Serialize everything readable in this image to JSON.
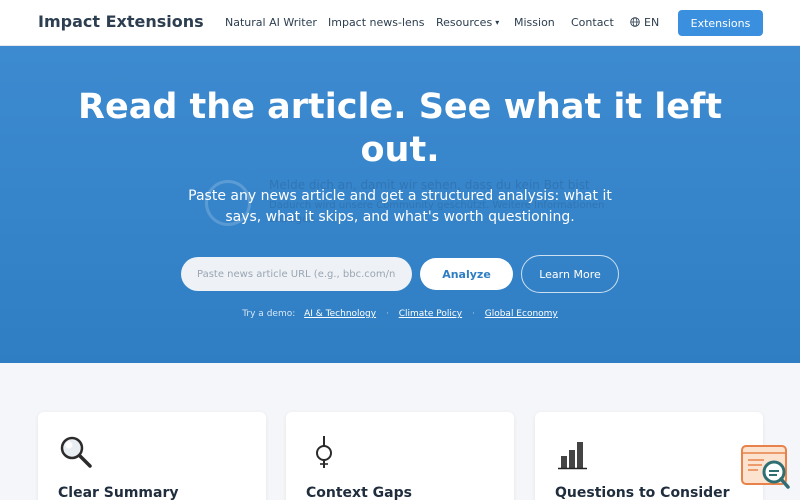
{
  "nav": {
    "brand": "Impact Extensions",
    "links": [
      "Natural AI Writer",
      "Impact news-lens",
      "Resources",
      "Mission",
      "Contact"
    ],
    "language": "EN",
    "extensions_button": "Extensions"
  },
  "hero": {
    "title": "Read the article. See what it left out.",
    "subtitle": "Paste any news article and get a structured analysis: what it says, what it skips, and what's worth questioning.",
    "overlay_lines": [
      "Melde dich an, damit wir sehen, dass du kein Bot bist",
      "Dadurch wird unsere Community geschützt. Weitere Informationen",
      "anzeigen"
    ],
    "input_placeholder": "Paste news article URL (e.g., bbc.com/news/...)",
    "analyze_button": "Analyze",
    "learn_more_button": "Learn More",
    "demo_label": "Try a demo:",
    "demo_links": [
      "AI & Technology",
      "Climate Policy",
      "Global Economy"
    ]
  },
  "cards": [
    {
      "title": "Clear Summary",
      "icon": "magnifier-icon"
    },
    {
      "title": "Context Gaps",
      "icon": "lightbulb-icon"
    },
    {
      "title": "Questions to Consider",
      "icon": "bar-chart-icon"
    }
  ],
  "colors": {
    "accent": "#3a8fde",
    "hero_background": "#3585cb",
    "title_text": "#2c3e50"
  }
}
